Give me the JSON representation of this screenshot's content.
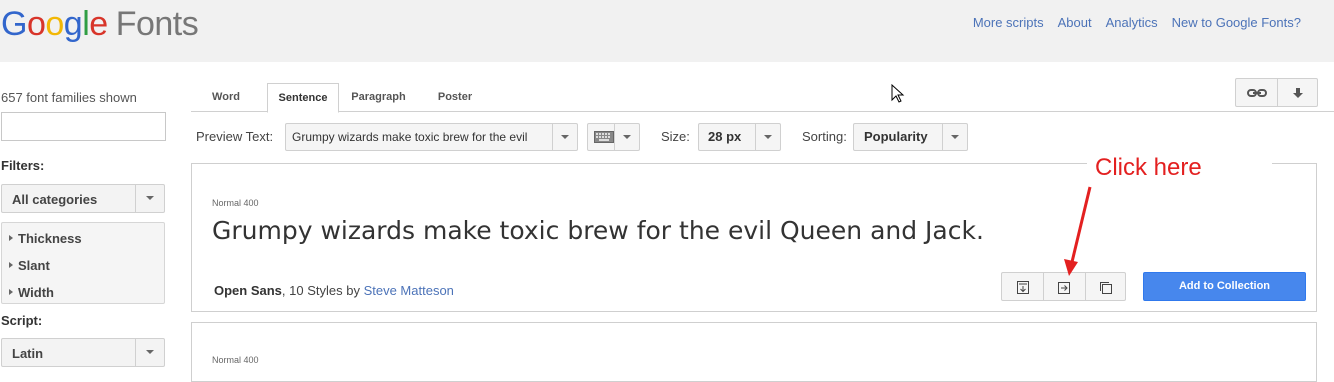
{
  "header": {
    "logo_letters": [
      "G",
      "o",
      "o",
      "g",
      "l",
      "e"
    ],
    "logo_product": "Fonts",
    "nav": [
      "More scripts",
      "About",
      "Analytics",
      "New to Google Fonts?"
    ]
  },
  "sidebar": {
    "count_text": "657 font families shown",
    "search_value": "",
    "filters_label": "Filters:",
    "category_select": "All categories",
    "filter_items": [
      "Thickness",
      "Slant",
      "Width"
    ],
    "script_label": "Script:",
    "script_select": "Latin"
  },
  "tabs": [
    "Word",
    "Sentence",
    "Paragraph",
    "Poster"
  ],
  "active_tab": "Sentence",
  "top_icons": [
    "link-icon",
    "download-icon"
  ],
  "toolbar": {
    "preview_label": "Preview Text:",
    "preview_value": "Grumpy wizards make toxic brew for the evil",
    "keyboard_icon": "keyboard-icon",
    "size_label": "Size:",
    "size_value": "28 px",
    "sorting_label": "Sorting:",
    "sorting_value": "Popularity"
  },
  "cards": [
    {
      "weight": "Normal 400",
      "sample": "Grumpy wizards make toxic brew for the evil Queen and Jack.",
      "family": "Open Sans",
      "styles_text": ", 10 Styles by ",
      "author": "Steve Matteson",
      "action_icons": [
        "quick-use-icon",
        "pop-out-icon",
        "collection-view-icon"
      ],
      "add_label": "Add to Collection"
    },
    {
      "weight": "Normal 400"
    }
  ],
  "annotation": {
    "text": "Click here",
    "color": "#e32020"
  },
  "colors": {
    "link": "#4c73b8",
    "primary_button": "#4787ed",
    "header_bg": "#f1f1f1"
  }
}
